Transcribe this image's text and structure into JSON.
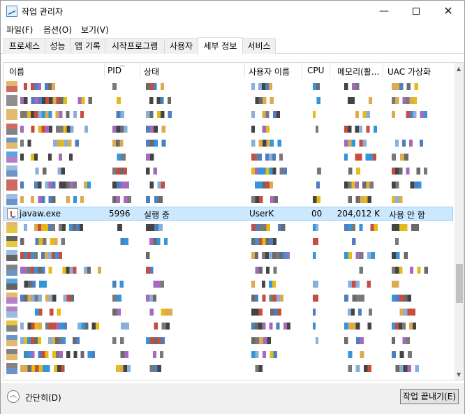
{
  "window": {
    "title": "작업 관리자",
    "controls": {
      "minimize": "—",
      "close": "✕"
    }
  },
  "menu": [
    {
      "label": "파일(F)"
    },
    {
      "label": "옵션(O)"
    },
    {
      "label": "보기(V)"
    }
  ],
  "tabs": [
    {
      "label": "프로세스"
    },
    {
      "label": "성능"
    },
    {
      "label": "앱 기록"
    },
    {
      "label": "시작프로그램"
    },
    {
      "label": "사용자"
    },
    {
      "label": "세부 정보",
      "active": true
    },
    {
      "label": "서비스"
    }
  ],
  "columns": {
    "name": "이름",
    "pid": "PID",
    "status": "상태",
    "user": "사용자 이름",
    "cpu": "CPU",
    "memory": "메모리(활...",
    "uac": "UAC 가상화"
  },
  "selected_row": {
    "name": "javaw.exe",
    "pid": "5996",
    "status": "실행 중",
    "user": "UserK",
    "cpu": "00",
    "memory": "204,012 K",
    "uac": "사용 안 함"
  },
  "footer": {
    "fewer_details": "간단히(D)",
    "end_task": "작업 끝내기(E)"
  },
  "colors": {
    "selection_bg": "#cce8ff",
    "selection_border": "#99d1ff",
    "pixelated_text": "#2f2f2f"
  },
  "icons": {
    "app": "task-manager-icon",
    "fewer_details": "chevron-up-circle-icon",
    "java": "java-icon"
  }
}
